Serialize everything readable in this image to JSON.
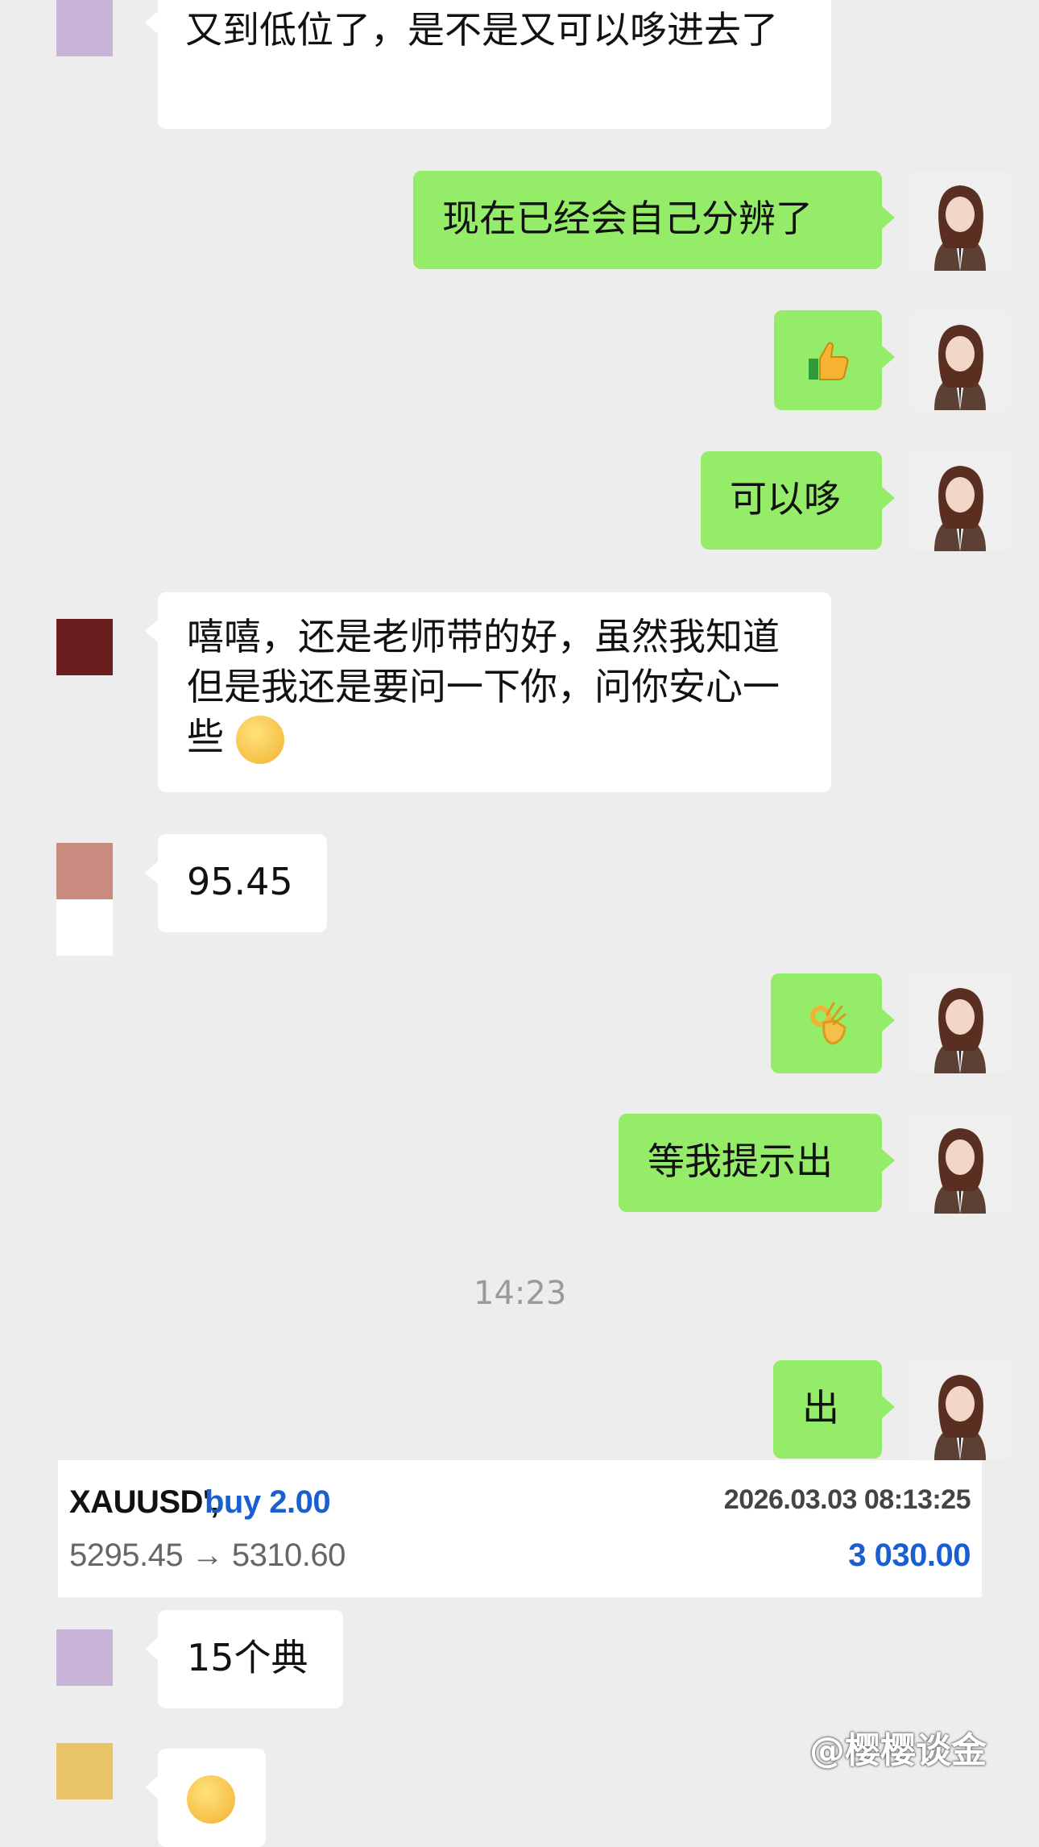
{
  "chat": {
    "messages": [
      {
        "side": "left",
        "text": "又到低位了，是不是又可以哆进去了",
        "avatar_color": "#c8b4d6"
      },
      {
        "side": "right",
        "text": "现在已经会自己分辨了"
      },
      {
        "side": "right",
        "emoji": "thumbs-up-icon"
      },
      {
        "side": "right",
        "text": "可以哆"
      },
      {
        "side": "left",
        "text": "嘻嘻，还是老师带的好，虽然我知道但是我还是要问一下你，问你安心一些",
        "avatar_color": "#6b1e1e"
      },
      {
        "side": "left",
        "text": "95.45",
        "avatar_color": "#c98b80"
      },
      {
        "side": "right",
        "emoji": "ok-hand-icon"
      },
      {
        "side": "right",
        "text": "等我提示出"
      },
      {
        "side": "right",
        "text": "出"
      },
      {
        "side": "left",
        "text": "15个典",
        "avatar_color": "#c8b4d6"
      },
      {
        "side": "left",
        "emoji": "face-emoji-icon",
        "avatar_color": "#e8c466"
      }
    ],
    "timestamp": "14:23"
  },
  "trade": {
    "symbol": "XAUUSD',",
    "action": "buy 2.00",
    "datetime": "2026.03.03 08:13:25",
    "prices": "5295.45 → 5310.60",
    "profit": "3 030.00"
  },
  "watermark": "@樱樱谈金",
  "colors": {
    "background": "#ededed",
    "bubble_right": "#95ec69",
    "bubble_left": "#ffffff",
    "profit_blue": "#1a5fd0",
    "action_blue": "#1a5fd0"
  }
}
